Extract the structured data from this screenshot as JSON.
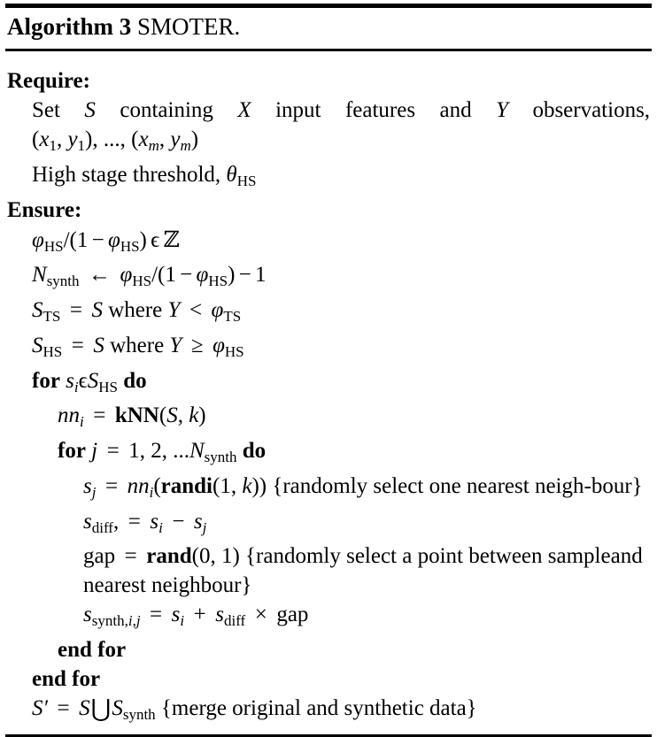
{
  "header": {
    "keyword": "Algorithm",
    "number": "3",
    "name": "SMOTER."
  },
  "sections": {
    "require_label": "Require:",
    "ensure_label": "Ensure:"
  },
  "lines": {
    "require_1_a": "Set",
    "require_1_b": "S",
    "require_1_c": "containing",
    "require_1_d": "X",
    "require_1_e": "input",
    "require_1_f": "features",
    "require_1_g": "and",
    "require_1_h": "Y",
    "require_1_i": "observations,",
    "require_2": "(x₁, y₁), ..., (xₘ, yₘ)",
    "require_3": "High stage threshold, θHS",
    "ensure_1": "φHS/(1 − φHS) ϵ ℤ",
    "ensure_2": "Nsynth ← φHS/(1 − φHS) − 1",
    "ensure_3": "STS = S where Y < φTS",
    "ensure_4": "SHS = S where Y ≥ φHS",
    "for_outer": "for si ϵ SHS do",
    "knn": "nni = kNN(S, k)",
    "for_inner": "for j = 1, 2, ...Nsynth do",
    "select_neighbour": "sj = nni(randi(1, k)) {randomly select one nearest neighbour}",
    "sdiff": "sdiff, = si − sj",
    "gap": "gap = rand(0, 1) {randomly select a point between sample and nearest neighbour}",
    "ssynth": "ssynth,i,j = si + sdiff × gap",
    "end_for_inner": "end for",
    "end_for_outer": "end for",
    "merge": "S′ = S ⋃ Ssynth {merge original and synthetic data}"
  },
  "tokens": {
    "for": "for",
    "do": "do",
    "end_for": "end for",
    "kNN": "kNN",
    "randi": "randi",
    "rand": "rand",
    "where": "where",
    "comment_neighbour_1": "{randomly select one nearest neigh-",
    "comment_neighbour_2": "bour}",
    "comment_gap_1": "{randomly select a point between sample",
    "comment_gap_2": "and nearest neighbour}",
    "comment_merge": "{merge original and synthetic data}"
  },
  "colors": {
    "text": "#000000",
    "rule": "#000000",
    "background": "#ffffff"
  }
}
